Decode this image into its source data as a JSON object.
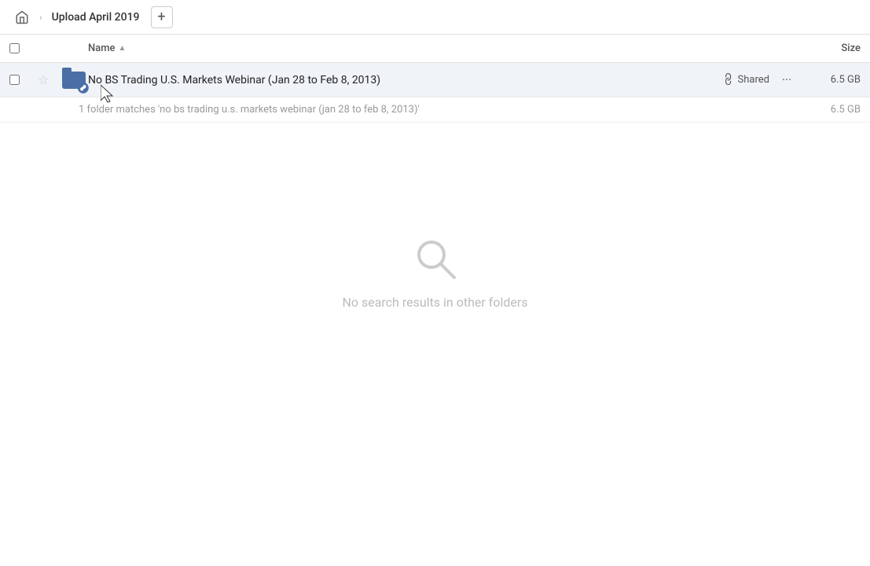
{
  "topbar": {
    "home_label": "Home",
    "breadcrumb_label": "Upload April 2019",
    "add_button_label": "+"
  },
  "table": {
    "col_name_label": "Name",
    "col_size_label": "Size",
    "sort_indicator": "▲"
  },
  "file_row": {
    "name": "No BS Trading U.S. Markets Webinar (Jan 28 to Feb 8, 2013)",
    "shared_label": "Shared",
    "size": "6.5 GB",
    "more_label": "···"
  },
  "summary": {
    "text": "1 folder matches 'no bs trading u.s. markets webinar (jan 28 to feb 8, 2013)'",
    "size": "6.5 GB"
  },
  "empty_state": {
    "message": "No search results in other folders"
  }
}
